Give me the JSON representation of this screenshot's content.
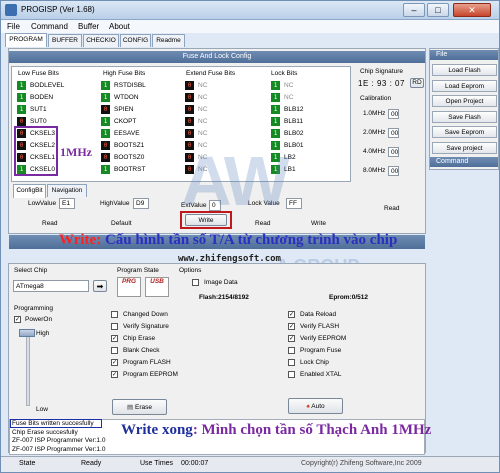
{
  "window": {
    "title": "PROGISP (Ver 1.68)",
    "min": "–",
    "max": "□",
    "close": "✕"
  },
  "menu": [
    "File",
    "Command",
    "Buffer",
    "About"
  ],
  "tabs": [
    "PROGRAM",
    "BUFFER",
    "CHECKIO",
    "CONFIG",
    "Readme"
  ],
  "fuse": {
    "header": "Fuse And Lock Config",
    "low_title": "Low Fuse Bits",
    "high_title": "High Fuse Bits",
    "ext_title": "Extend Fuse Bits",
    "lock_title": "Lock Bits",
    "low": [
      {
        "bit": "1",
        "name": "BODLEVEL"
      },
      {
        "bit": "1",
        "name": "BODEN"
      },
      {
        "bit": "1",
        "name": "SUT1"
      },
      {
        "bit": "0",
        "name": "SUT0"
      },
      {
        "bit": "0",
        "name": "CKSEL3"
      },
      {
        "bit": "0",
        "name": "CKSEL2"
      },
      {
        "bit": "0",
        "name": "CKSEL1"
      },
      {
        "bit": "1",
        "name": "CKSEL0"
      }
    ],
    "high": [
      {
        "bit": "1",
        "name": "RSTDISBL"
      },
      {
        "bit": "1",
        "name": "WTDON"
      },
      {
        "bit": "0",
        "name": "SPIEN"
      },
      {
        "bit": "1",
        "name": "CKOPT"
      },
      {
        "bit": "1",
        "name": "EESAVE"
      },
      {
        "bit": "0",
        "name": "BOOTSZ1"
      },
      {
        "bit": "0",
        "name": "BOOTSZ0"
      },
      {
        "bit": "1",
        "name": "BOOTRST"
      }
    ],
    "ext": [
      {
        "bit": "0",
        "name": "NC"
      },
      {
        "bit": "0",
        "name": "NC"
      },
      {
        "bit": "0",
        "name": "NC"
      },
      {
        "bit": "0",
        "name": "NC"
      },
      {
        "bit": "0",
        "name": "NC"
      },
      {
        "bit": "0",
        "name": "NC"
      },
      {
        "bit": "0",
        "name": "NC"
      },
      {
        "bit": "0",
        "name": "NC"
      }
    ],
    "lock": [
      {
        "bit": "1",
        "name": "NC"
      },
      {
        "bit": "1",
        "name": "NC"
      },
      {
        "bit": "1",
        "name": "BLB12"
      },
      {
        "bit": "1",
        "name": "BLB11"
      },
      {
        "bit": "1",
        "name": "BLB02"
      },
      {
        "bit": "1",
        "name": "BLB01"
      },
      {
        "bit": "1",
        "name": "LB2"
      },
      {
        "bit": "1",
        "name": "LB1"
      }
    ]
  },
  "signature": {
    "title": "Chip Signature",
    "value": "1E : 93 : 07",
    "rd": "RD"
  },
  "calibration": {
    "title": "Calibration",
    "rows": [
      {
        "label": "1.0MHz",
        "value": "00"
      },
      {
        "label": "2.0MHz",
        "value": "00"
      },
      {
        "label": "4.0MHz",
        "value": "00"
      },
      {
        "label": "8.0MHz",
        "value": "00"
      }
    ]
  },
  "config_tabs": [
    "ConfigBit",
    "Navigation"
  ],
  "values": {
    "low_label": "LowValue",
    "low_value": "E1",
    "high_label": "HighValue",
    "high_value": "D9",
    "ext_label": "ExtValue",
    "ext_value": "0",
    "lock_label": "Lock Value",
    "lock_value": "FF",
    "read": "Read",
    "default": "Default",
    "write": "Write",
    "read2": "Read",
    "write2": "Write",
    "read3": "Read"
  },
  "side": {
    "file_title": "File",
    "buttons": [
      "Load Flash",
      "Load Eeprom",
      "Open Project",
      "Save Flash",
      "Save Eeprom",
      "Save project"
    ],
    "command_title": "Command"
  },
  "chip": {
    "title": "Select Chip",
    "value": "ATmega8",
    "arrow": "➡"
  },
  "program_state": {
    "title": "Program State",
    "prg": "PRG",
    "usb": "USB"
  },
  "options": {
    "title": "Options",
    "image_data": "Image Data",
    "flash": "Flash:2154/8192",
    "eprom": "Eprom:0/512"
  },
  "programming": {
    "title": "Programming",
    "power_on": "PowerOn",
    "high": "High",
    "low": "Low",
    "checks_left": [
      {
        "label": "Changed Down",
        "checked": false
      },
      {
        "label": "Verify Signature",
        "checked": false
      },
      {
        "label": "Chip Erase",
        "checked": true
      },
      {
        "label": "Blank Check",
        "checked": false
      },
      {
        "label": "Program FLASH",
        "checked": true
      },
      {
        "label": "Program EEPROM",
        "checked": true
      }
    ],
    "checks_right": [
      {
        "label": "Data Reload",
        "checked": true
      },
      {
        "label": "Verify FLASH",
        "checked": true
      },
      {
        "label": "Verify EEPROM",
        "checked": true
      },
      {
        "label": "Program Fuse",
        "checked": false
      },
      {
        "label": "Lock Chip",
        "checked": false
      },
      {
        "label": "Enabled XTAL",
        "checked": false
      }
    ],
    "erase": "Erase",
    "auto": "Auto"
  },
  "log": [
    "Fuse Bits written succesfully",
    "Chip Erase succesfully",
    "ZF-007 ISP Programmer Ver:1.0",
    "ZF-007 ISP Programmer Ver:1.0"
  ],
  "annotations": {
    "mhz": "1MHz",
    "write_prefix": "Write:",
    "write_text": " Cấu hình tần số T/A từ chương trình vào chip",
    "url": "www.zhifengsoft.com",
    "done_prefix": "Write xong",
    "done_text": ": Mình chọn tần số Thạch Anh 1MHz",
    "watermark": "A GROUP"
  },
  "status": {
    "state_label": "State",
    "state_value": "Ready",
    "use_times_label": "Use Times",
    "use_times_value": "00:00:07",
    "copyright": "Copyright(r) Zhifeng Software,Inc 2009"
  }
}
